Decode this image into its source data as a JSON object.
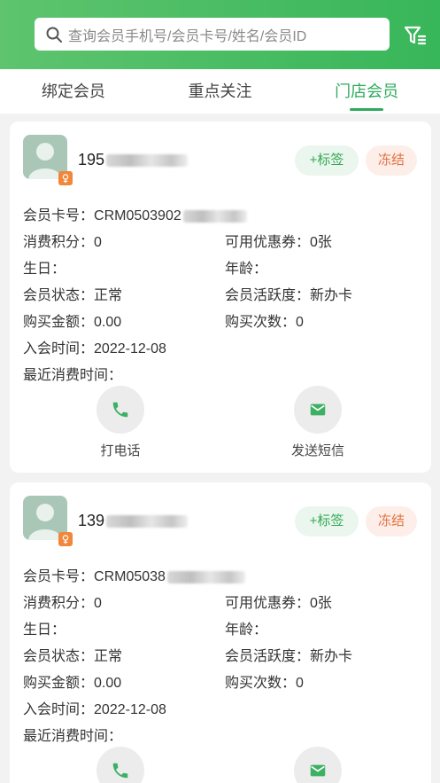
{
  "search": {
    "placeholder": "查询会员手机号/会员卡号/姓名/会员ID"
  },
  "tabs": [
    {
      "label": "绑定会员"
    },
    {
      "label": "重点关注"
    },
    {
      "label": "门店会员"
    }
  ],
  "labels": {
    "card_no": "会员卡号：",
    "points": "消费积分：",
    "coupons": "可用优惠券：",
    "birthday": "生日：",
    "age": "年龄：",
    "status": "会员状态：",
    "activity": "会员活跃度：",
    "amount": "购买金额：",
    "count": "购买次数：",
    "join": "入会时间：",
    "last": "最近消费时间："
  },
  "actions": {
    "tag": "+标签",
    "freeze": "冻结",
    "call": "打电话",
    "sms": "发送短信"
  },
  "members": [
    {
      "phone": "195",
      "card_no": "CRM0503902",
      "points": "0",
      "coupons": "0张",
      "birthday": "",
      "age": "",
      "status": "正常",
      "activity": "新办卡",
      "amount": "0.00",
      "count": "0",
      "join": "2022-12-08",
      "last": ""
    },
    {
      "phone": "139",
      "card_no": "CRM05038",
      "points": "0",
      "coupons": "0张",
      "birthday": "",
      "age": "",
      "status": "正常",
      "activity": "新办卡",
      "amount": "0.00",
      "count": "0",
      "join": "2022-12-08",
      "last": ""
    }
  ],
  "colors": {
    "primary": "#34a853",
    "header": "#38b65a",
    "freeze": "#e2733f"
  }
}
